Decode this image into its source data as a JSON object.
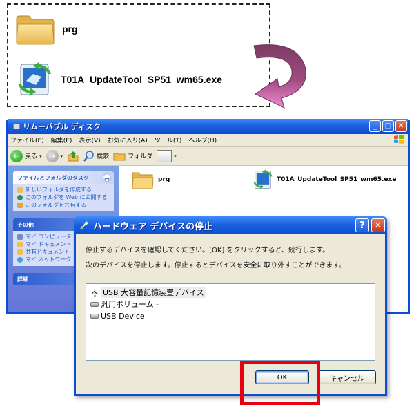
{
  "callout": {
    "folder_label": "prg",
    "exe_label": "T01A_UpdateTool_SP51_wm65.exe"
  },
  "explorer": {
    "title": "リムーバブル ディスク",
    "menu": [
      "ファイル(E)",
      "編集(E)",
      "表示(V)",
      "お気に入り(A)",
      "ツール(T)",
      "ヘルプ(H)"
    ],
    "toolbar": {
      "back": "戻る",
      "search": "検索",
      "folders": "フォルダ"
    },
    "task_panel": {
      "title": "ファイルとフォルダのタスク",
      "items": [
        "新しいフォルダを作成する",
        "このフォルダを Web に公開する",
        "このフォルダを共有する"
      ]
    },
    "other_panel": {
      "title": "その他",
      "items": [
        "マイ コンピュータ",
        "マイ ドキュメント",
        "共有ドキュメント",
        "マイ ネットワーク"
      ]
    },
    "details_panel": {
      "title": "詳細"
    },
    "files": {
      "folder": "prg",
      "exe": "T01A_UpdateTool_SP51_wm65.exe"
    }
  },
  "dialog": {
    "title": "ハードウェア デバイスの停止",
    "line1": "停止するデバイスを確認してください。[OK] をクリックすると、続行します。",
    "line2": "次のデバイスを停止します。停止するとデバイスを安全に取り外すことができます。",
    "devices": [
      "USB 大容量記憶装置デバイス",
      "汎用ボリューム -",
      "USB Device"
    ],
    "ok_label": "OK",
    "cancel_label": "キャンセル"
  },
  "colors": {
    "highlight": "#e60012",
    "xp_blue": "#0a4fd6"
  }
}
